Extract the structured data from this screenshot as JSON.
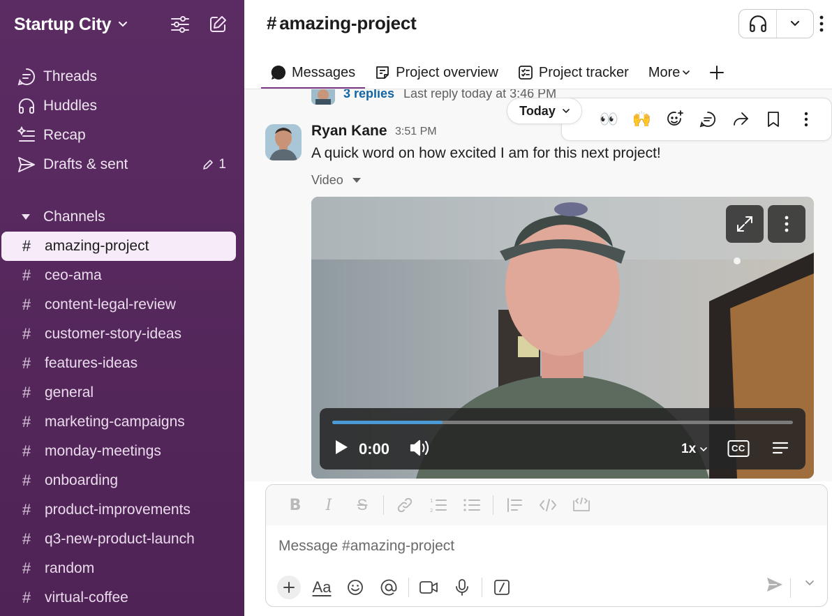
{
  "workspace": {
    "name": "Startup City"
  },
  "nav": [
    {
      "label": "Threads",
      "icon": "threads-icon"
    },
    {
      "label": "Huddles",
      "icon": "headphones-icon"
    },
    {
      "label": "Recap",
      "icon": "recap-icon"
    },
    {
      "label": "Drafts & sent",
      "icon": "send-icon",
      "count": "1"
    }
  ],
  "channels_section": {
    "label": "Channels"
  },
  "channels": [
    {
      "name": "amazing-project",
      "active": true
    },
    {
      "name": "ceo-ama"
    },
    {
      "name": "content-legal-review"
    },
    {
      "name": "customer-story-ideas"
    },
    {
      "name": "features-ideas"
    },
    {
      "name": "general"
    },
    {
      "name": "marketing-campaigns"
    },
    {
      "name": "monday-meetings"
    },
    {
      "name": "onboarding"
    },
    {
      "name": "product-improvements"
    },
    {
      "name": "q3-new-product-launch"
    },
    {
      "name": "random"
    },
    {
      "name": "virtual-coffee"
    }
  ],
  "channel": {
    "hash": "#",
    "title": "amazing-project"
  },
  "tabs": [
    {
      "label": "Messages",
      "active": true
    },
    {
      "label": "Project overview"
    },
    {
      "label": "Project tracker"
    },
    {
      "label": "More"
    }
  ],
  "thread_summary": {
    "replies": "3 replies",
    "last_reply": "Last reply today at 3:46 PM"
  },
  "day_divider": {
    "label": "Today"
  },
  "message": {
    "author": "Ryan Kane",
    "time": "3:51 PM",
    "text": "A quick word on how excited I am for this next project!",
    "attachment_label": "Video"
  },
  "video": {
    "time": "0:00",
    "speed": "1x",
    "cc": "CC",
    "progress": 0.24
  },
  "reactions_bar": {
    "emoji_eyes": "👀",
    "emoji_hands": "🙌"
  },
  "composer": {
    "placeholder": "Message #amazing-project",
    "font_label": "Aa"
  },
  "colors": {
    "sidebar": "#5b2c63",
    "active_channel_bg": "#f7ebfa",
    "tab_underline": "#7b3a84",
    "link": "#1264a3",
    "progress": "#4c9ad5"
  }
}
